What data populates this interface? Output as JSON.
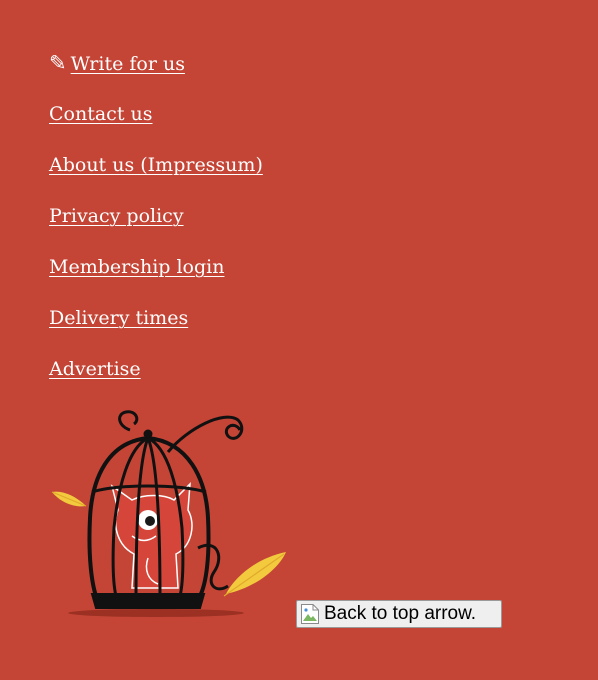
{
  "footer": {
    "write_icon": "pencil-icon",
    "write_label": "Write for us",
    "contact_label": "Contact us",
    "about_label": "About us (Impressum)",
    "privacy_label": "Privacy policy",
    "membership_label": "Membership login",
    "delivery_label": "Delivery times",
    "advertise_label": "Advertise"
  },
  "back_to_top": {
    "alt_text": "Back to top arrow.",
    "icon": "broken-image-icon"
  },
  "colors": {
    "background": "#c44536",
    "link": "#ffffff",
    "feather": "#f3c93e"
  }
}
